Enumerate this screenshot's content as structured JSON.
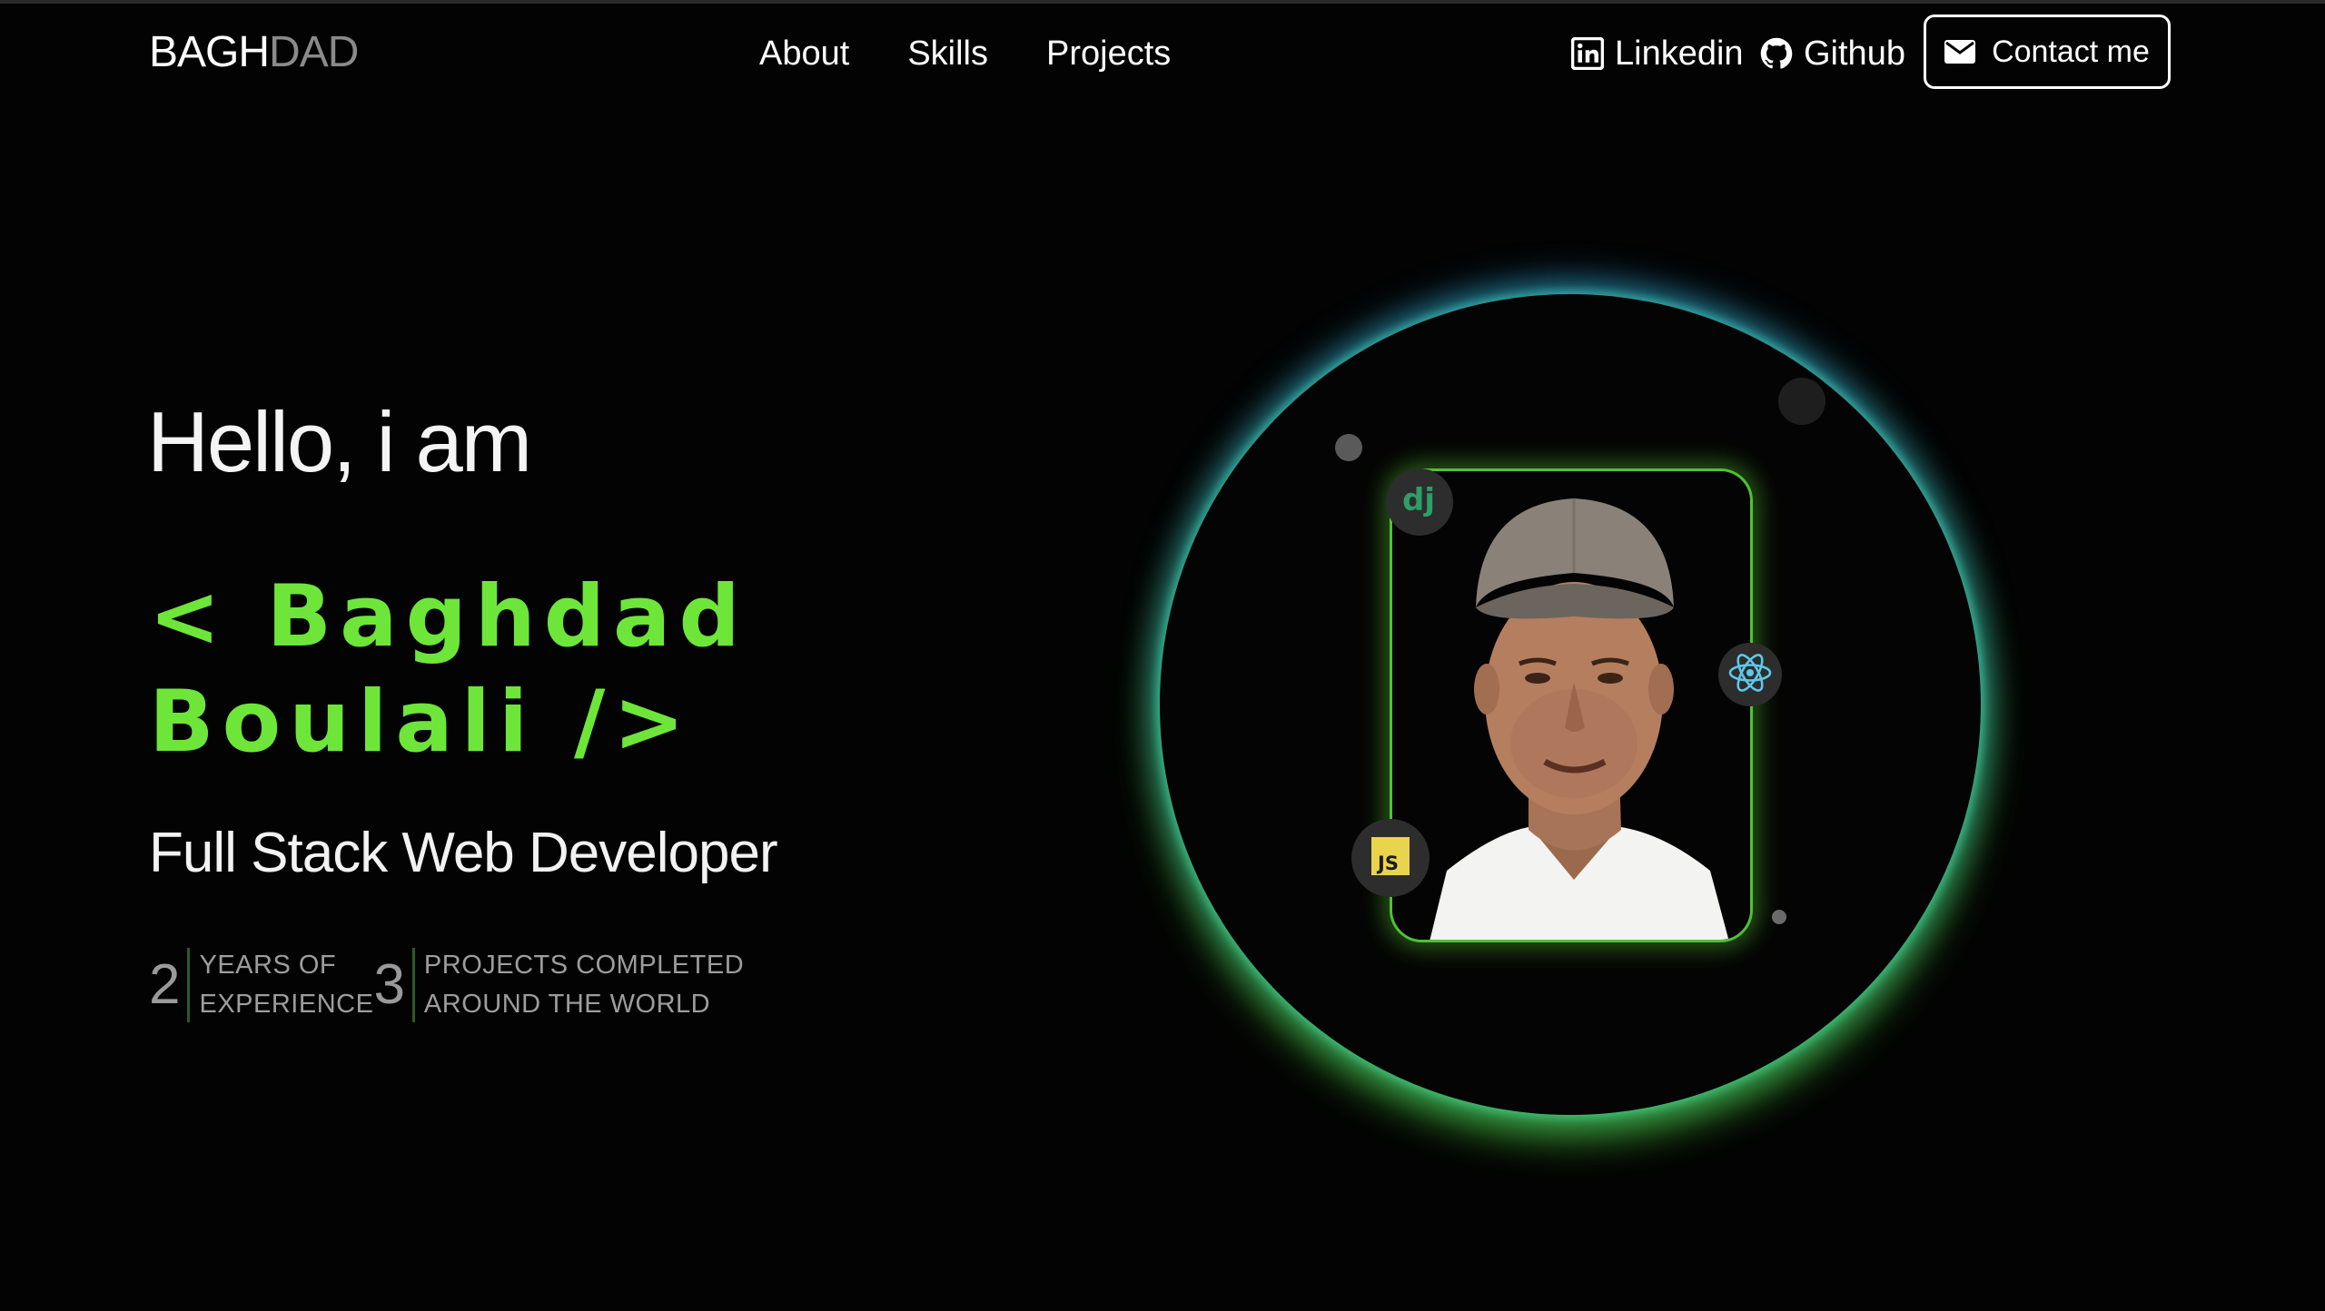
{
  "nav": {
    "logo_primary": "BAGH",
    "logo_secondary": "DAD",
    "links": [
      "About",
      "Skills",
      "Projects"
    ],
    "social": {
      "linkedin_label": "Linkedin",
      "github_label": "Github"
    },
    "contact_label": "Contact me"
  },
  "hero": {
    "greeting": "Hello, i am",
    "name_line1": "< Baghdad",
    "name_line2": "Boulali />",
    "role": "Full Stack Web Developer",
    "stats": [
      {
        "value": "2",
        "label_line1": "YEARS OF",
        "label_line2": "EXPERIENCE"
      },
      {
        "value": "3",
        "label_line1": "PROJECTS COMPLETED",
        "label_line2": "AROUND THE WORLD"
      }
    ]
  },
  "badges": [
    "django-icon",
    "react-icon",
    "javascript-icon"
  ],
  "colors": {
    "background": "#030303",
    "accent_green": "#6de639",
    "ring_blue": "#2a8fd6",
    "ring_green": "#5fdc3c",
    "muted_text": "#9d9d9d"
  }
}
